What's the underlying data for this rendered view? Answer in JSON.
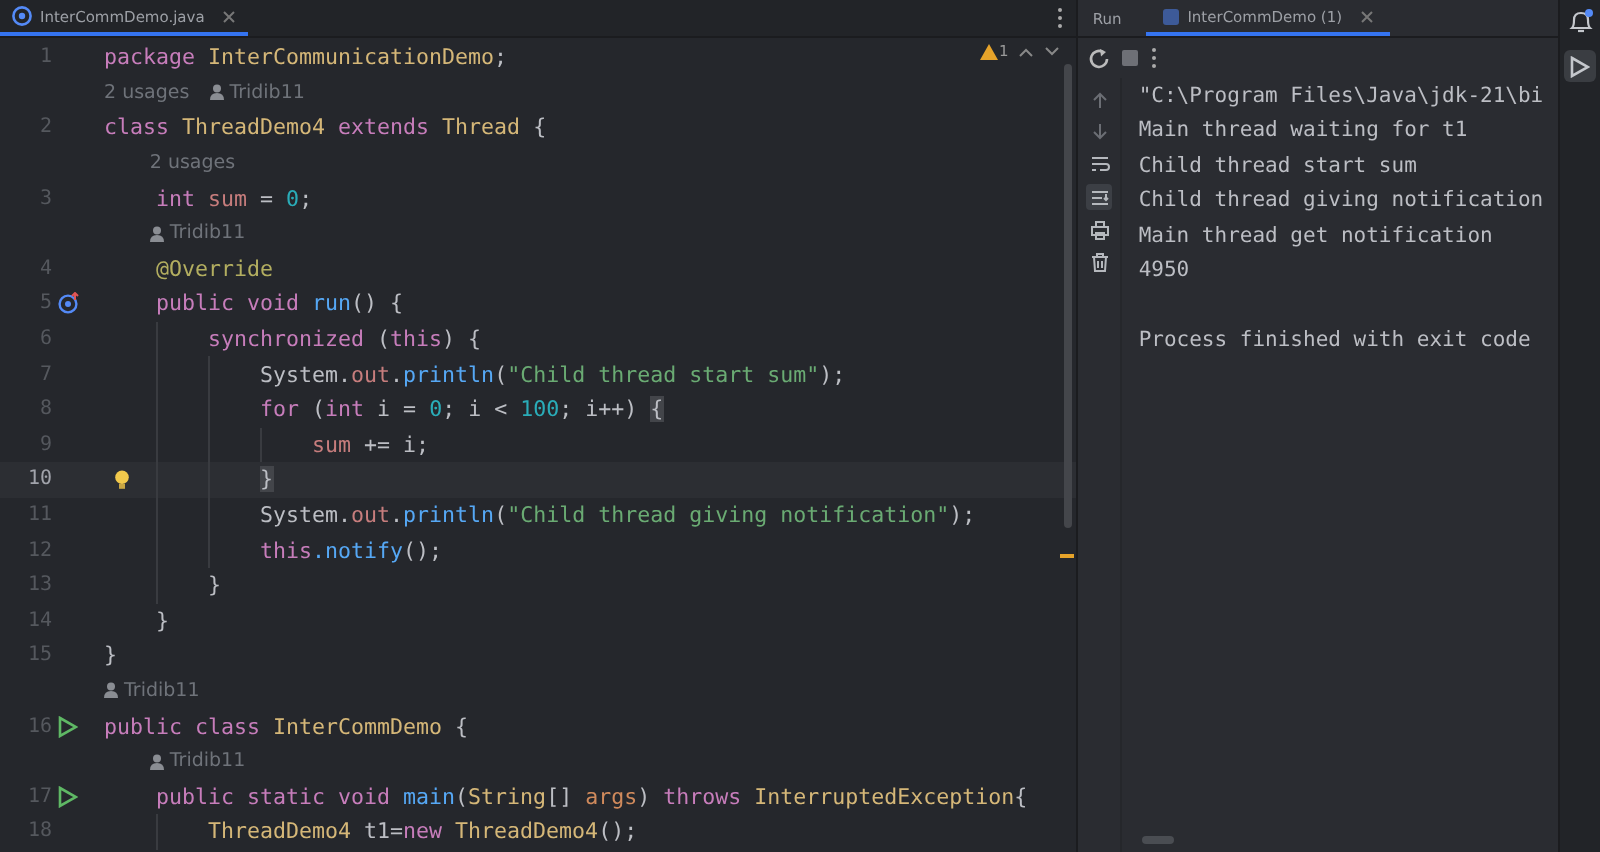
{
  "editor": {
    "tabs": [
      {
        "label": "InterCommDemo.java",
        "selected": true
      }
    ],
    "inspection": {
      "warnings": "1"
    },
    "lines": [
      {
        "kind": "code",
        "number": "1",
        "tokens": [
          {
            "text": "package ",
            "kind": "kw"
          },
          {
            "text": "InterCommunicationDemo",
            "kind": "cls"
          },
          {
            "text": ";",
            "kind": "plain"
          }
        ]
      },
      {
        "kind": "hint",
        "items": [
          {
            "kind": "usages",
            "text": "2 usages"
          },
          {
            "kind": "author",
            "text": "Tridib11"
          }
        ]
      },
      {
        "kind": "code",
        "number": "2",
        "tokens": [
          {
            "text": "class ",
            "kind": "kw"
          },
          {
            "text": "ThreadDemo4 ",
            "kind": "cls"
          },
          {
            "text": "extends ",
            "kind": "kw"
          },
          {
            "text": "Thread",
            "kind": "cls"
          },
          {
            "text": " {",
            "kind": "plain"
          }
        ]
      },
      {
        "kind": "hint",
        "items": [
          {
            "kind": "usages",
            "text": "2 usages"
          }
        ]
      },
      {
        "kind": "code",
        "number": "3",
        "tokens": [
          {
            "text": "    int ",
            "kind": "kw"
          },
          {
            "text": "sum",
            "kind": "field"
          },
          {
            "text": " = ",
            "kind": "plain"
          },
          {
            "text": "0",
            "kind": "num"
          },
          {
            "text": ";",
            "kind": "plain"
          }
        ]
      },
      {
        "kind": "hint",
        "items": [
          {
            "kind": "author",
            "text": "Tridib11"
          }
        ]
      },
      {
        "kind": "code",
        "number": "4",
        "tokens": [
          {
            "text": "    @Override",
            "kind": "ann"
          }
        ]
      },
      {
        "kind": "code",
        "number": "5",
        "gutter": {
          "kind": "override"
        },
        "tokens": [
          {
            "text": "    public void ",
            "kind": "kw"
          },
          {
            "text": "run",
            "kind": "fn"
          },
          {
            "text": "() {",
            "kind": "plain"
          }
        ]
      },
      {
        "kind": "code",
        "number": "6",
        "tokens": [
          {
            "text": "        synchronized",
            "kind": "kw"
          },
          {
            "text": " (",
            "kind": "plain"
          },
          {
            "text": "this",
            "kind": "kw"
          },
          {
            "text": ") {",
            "kind": "plain"
          }
        ]
      },
      {
        "kind": "code",
        "number": "7",
        "tokens": [
          {
            "text": "            System.",
            "kind": "plain"
          },
          {
            "text": "out",
            "kind": "field"
          },
          {
            "text": ".",
            "kind": "plain"
          },
          {
            "text": "println",
            "kind": "fn"
          },
          {
            "text": "(",
            "kind": "plain"
          },
          {
            "text": "\"Child thread start sum\"",
            "kind": "str"
          },
          {
            "text": ");",
            "kind": "plain"
          }
        ]
      },
      {
        "kind": "code",
        "number": "8",
        "tokens": [
          {
            "text": "            for",
            "kind": "kw"
          },
          {
            "text": " (",
            "kind": "plain"
          },
          {
            "text": "int",
            "kind": "kw"
          },
          {
            "text": " i = ",
            "kind": "plain"
          },
          {
            "text": "0",
            "kind": "num"
          },
          {
            "text": "; i < ",
            "kind": "plain"
          },
          {
            "text": "100",
            "kind": "num"
          },
          {
            "text": "; i++) ",
            "kind": "plain"
          },
          {
            "text": "{",
            "kind": "match"
          }
        ]
      },
      {
        "kind": "code",
        "number": "9",
        "tokens": [
          {
            "text": "                sum",
            "kind": "field"
          },
          {
            "text": " += i;",
            "kind": "plain"
          }
        ]
      },
      {
        "kind": "code",
        "number": "10",
        "current": true,
        "gutter": {
          "kind": "bulb"
        },
        "tokens": [
          {
            "text": "            }",
            "kind": "match"
          }
        ]
      },
      {
        "kind": "code",
        "number": "11",
        "tokens": [
          {
            "text": "            System.",
            "kind": "plain"
          },
          {
            "text": "out",
            "kind": "field"
          },
          {
            "text": ".",
            "kind": "plain"
          },
          {
            "text": "println",
            "kind": "fn"
          },
          {
            "text": "(",
            "kind": "plain"
          },
          {
            "text": "\"Child thread giving notification\"",
            "kind": "str"
          },
          {
            "text": ");",
            "kind": "plain"
          }
        ]
      },
      {
        "kind": "code",
        "number": "12",
        "tokens": [
          {
            "text": "            this",
            "kind": "kw"
          },
          {
            "text": ".notify",
            "kind": "fn"
          },
          {
            "text": "();",
            "kind": "plain"
          }
        ]
      },
      {
        "kind": "code",
        "number": "13",
        "tokens": [
          {
            "text": "        }",
            "kind": "plain"
          }
        ]
      },
      {
        "kind": "code",
        "number": "14",
        "tokens": [
          {
            "text": "    }",
            "kind": "plain"
          }
        ]
      },
      {
        "kind": "code",
        "number": "15",
        "tokens": [
          {
            "text": "}",
            "kind": "plain"
          }
        ]
      },
      {
        "kind": "hint",
        "items": [
          {
            "kind": "author",
            "text": "Tridib11"
          }
        ]
      },
      {
        "kind": "code",
        "number": "16",
        "gutter": {
          "kind": "run"
        },
        "tokens": [
          {
            "text": "public class ",
            "kind": "kw"
          },
          {
            "text": "InterCommDemo",
            "kind": "cls"
          },
          {
            "text": " {",
            "kind": "plain"
          }
        ]
      },
      {
        "kind": "hint",
        "items": [
          {
            "kind": "author",
            "text": "Tridib11"
          }
        ]
      },
      {
        "kind": "code",
        "number": "17",
        "gutter": {
          "kind": "run"
        },
        "tokens": [
          {
            "text": "    public static void ",
            "kind": "kw"
          },
          {
            "text": "main",
            "kind": "fn"
          },
          {
            "text": "(",
            "kind": "plain"
          },
          {
            "text": "String",
            "kind": "cls"
          },
          {
            "text": "[] ",
            "kind": "plain"
          },
          {
            "text": "args",
            "kind": "param"
          },
          {
            "text": ") ",
            "kind": "plain"
          },
          {
            "text": "throws ",
            "kind": "kw"
          },
          {
            "text": "InterruptedException",
            "kind": "cls"
          },
          {
            "text": "{",
            "kind": "plain"
          }
        ]
      },
      {
        "kind": "code",
        "number": "18",
        "tokens": [
          {
            "text": "        ThreadDemo4",
            "kind": "cls"
          },
          {
            "text": " t1=",
            "kind": "plain"
          },
          {
            "text": "new ",
            "kind": "kw"
          },
          {
            "text": "ThreadDemo4",
            "kind": "cls"
          },
          {
            "text": "();",
            "kind": "plain"
          }
        ]
      }
    ]
  },
  "run_panel": {
    "title": "Run",
    "tabs": [
      {
        "label": "InterCommDemo (1)",
        "selected": true
      }
    ],
    "console": [
      "\"C:\\Program Files\\Java\\jdk-21\\bi",
      "Main thread waiting for t1",
      "Child thread start sum",
      "Child thread giving notification",
      "Main thread get notification",
      "4950",
      "Process finished with exit code"
    ],
    "side_tools": [
      {
        "kind": "up",
        "selected": false
      },
      {
        "kind": "down",
        "selected": false
      },
      {
        "kind": "wrap",
        "selected": false
      },
      {
        "kind": "scroll-end",
        "selected": true
      },
      {
        "kind": "print",
        "selected": false
      },
      {
        "kind": "trash",
        "selected": false
      }
    ]
  }
}
